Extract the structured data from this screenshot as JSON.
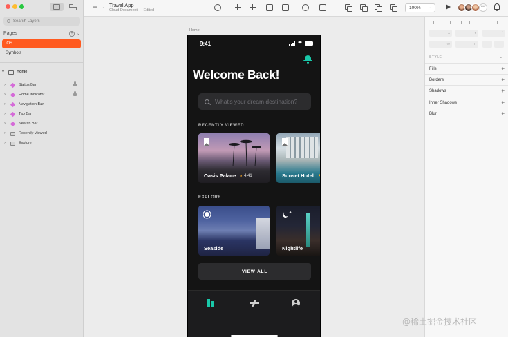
{
  "sidebar": {
    "search_placeholder": "Search Layers",
    "pages_header": "Pages",
    "pages": [
      "iOS",
      "Symbols"
    ],
    "artboard": "Home",
    "layers": [
      {
        "label": "Status Bar",
        "kind": "symbol",
        "locked": true
      },
      {
        "label": "Home Indicator",
        "kind": "symbol",
        "locked": true
      },
      {
        "label": "Navigation Bar",
        "kind": "symbol",
        "locked": false
      },
      {
        "label": "Tab Bar",
        "kind": "symbol",
        "locked": false
      },
      {
        "label": "Search Bar",
        "kind": "symbol",
        "locked": false
      },
      {
        "label": "Recently Viewed",
        "kind": "group",
        "locked": false
      },
      {
        "label": "Explore",
        "kind": "group",
        "locked": false
      }
    ]
  },
  "toolbar": {
    "doc_title": "Travel App",
    "doc_subtitle": "Cloud Document — Edited",
    "zoom": "100%"
  },
  "canvas": {
    "artboard_label": "Home"
  },
  "phone": {
    "time": "9:41",
    "heading": "Welcome Back!",
    "search_placeholder": "What's your dream destination?",
    "recent_header": "RECENTLY VIEWED",
    "recent": [
      {
        "name": "Oasis Palace",
        "rating": "4.41"
      },
      {
        "name": "Sunset Hotel",
        "rating": ""
      }
    ],
    "explore_header": "EXPLORE",
    "explore": [
      {
        "name": "Seaside",
        "icon": "sun-icon"
      },
      {
        "name": "Nightlife",
        "icon": "moon-icon"
      }
    ],
    "view_all": "VIEW ALL",
    "accent_color": "#19c8a9"
  },
  "inspector": {
    "style_header": "STYLE",
    "sections": [
      "Fills",
      "Borders",
      "Shadows",
      "Inner Shadows",
      "Blur"
    ]
  },
  "watermark": "@稀土掘金技术社区"
}
